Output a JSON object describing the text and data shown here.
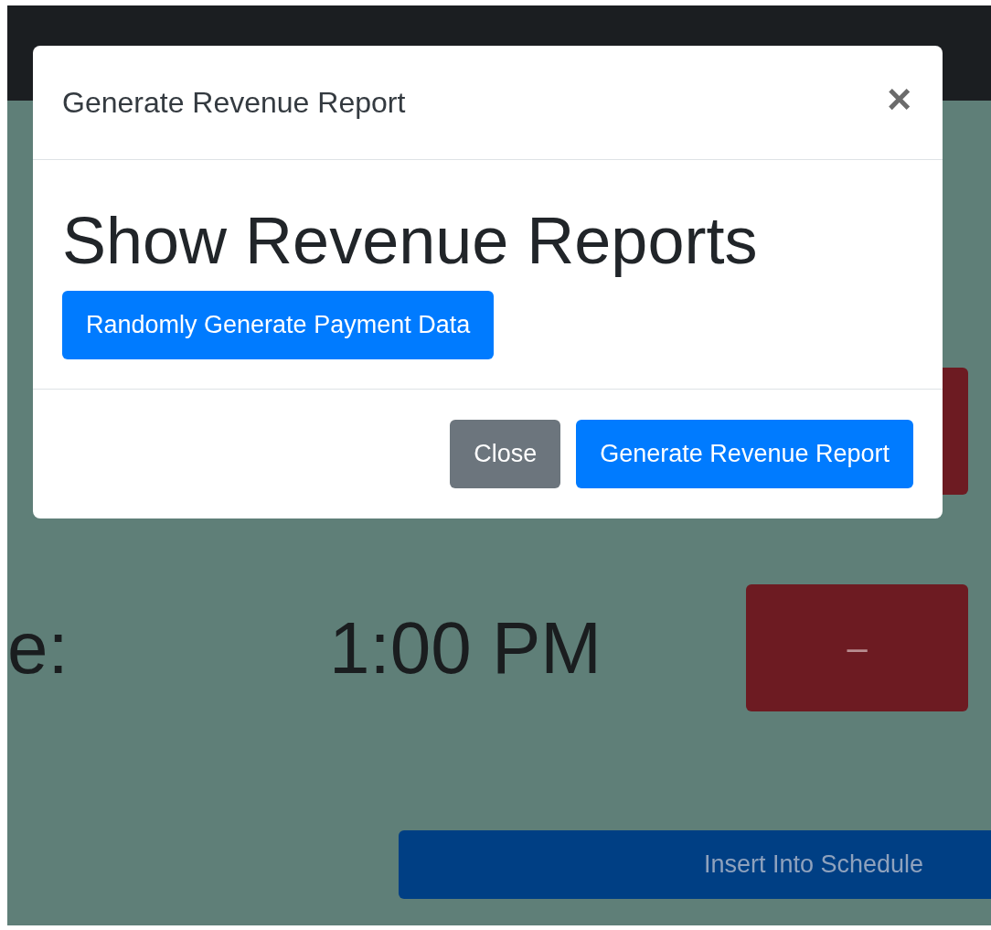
{
  "page_rows": [
    {
      "kind": "button_only"
    },
    {
      "kind": "time",
      "label": "e:",
      "time": "1:00 PM",
      "button": "–"
    }
  ],
  "insert_button": "Insert Into Schedule",
  "modal": {
    "title": "Generate Revenue Report",
    "close": "×",
    "heading": "Show Revenue Reports",
    "body_button": "Randomly Generate Payment Data",
    "footer_buttons": [
      {
        "label": "Close",
        "kind": "secondary"
      },
      {
        "label": "Generate Revenue Report",
        "kind": "primary"
      }
    ]
  }
}
